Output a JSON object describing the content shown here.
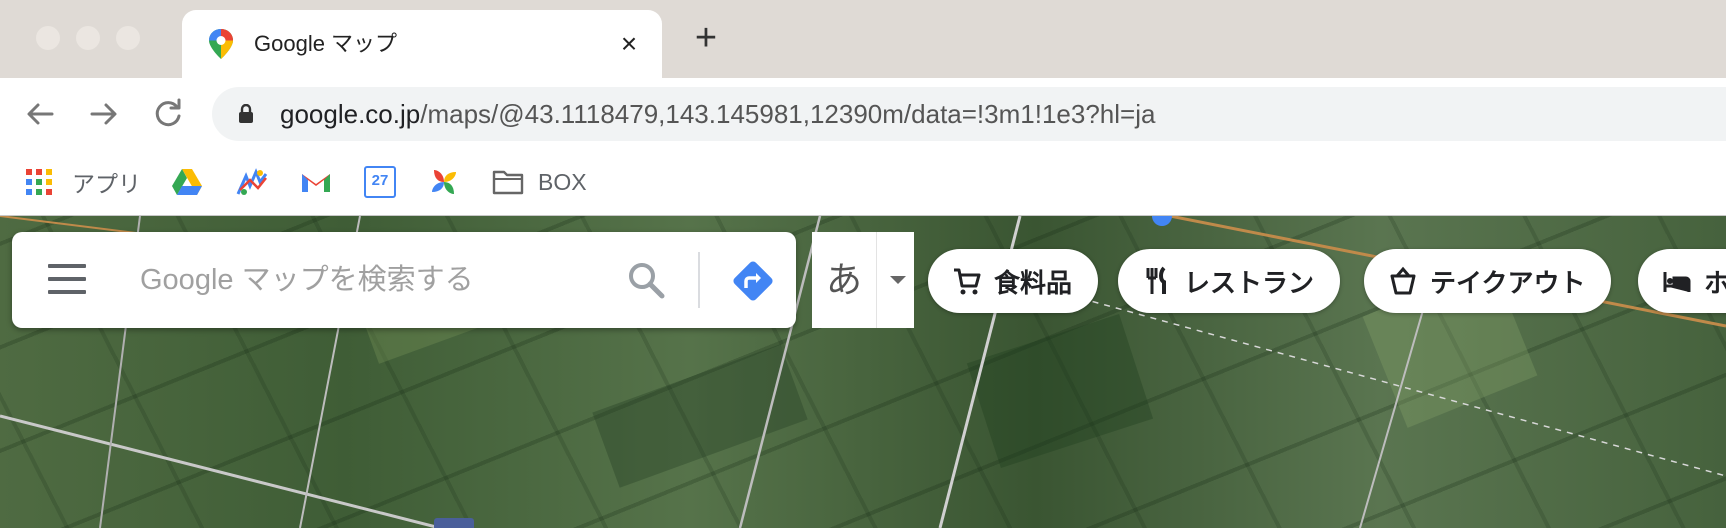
{
  "browser": {
    "tab": {
      "title": "Google マップ",
      "close_glyph": "×"
    },
    "new_tab_glyph": "+",
    "address": {
      "host": "google.co.jp",
      "path": "/maps/@43.1118479,143.145981,12390m/data=!3m1!1e3?hl=ja"
    },
    "bookmarks": [
      {
        "icon": "apps-grid-icon",
        "label": "アプリ"
      },
      {
        "icon": "google-drive-icon",
        "label": ""
      },
      {
        "icon": "colorful-app-icon",
        "label": ""
      },
      {
        "icon": "gmail-icon",
        "label": ""
      },
      {
        "icon": "google-calendar-icon",
        "label": "27"
      },
      {
        "icon": "google-photos-icon",
        "label": ""
      },
      {
        "icon": "folder-icon",
        "label": "BOX"
      }
    ]
  },
  "maps": {
    "search": {
      "placeholder": "Google マップを検索する",
      "value": ""
    },
    "ime": {
      "char": "あ"
    },
    "chips": [
      {
        "icon": "cart-icon",
        "label": "食料品"
      },
      {
        "icon": "restaurant-icon",
        "label": "レストラン"
      },
      {
        "icon": "takeout-icon",
        "label": "テイクアウト"
      },
      {
        "icon": "hotel-icon",
        "label": "ホ"
      }
    ]
  },
  "colors": {
    "accent_blue": "#4285f4",
    "map_green": "#4f6b42"
  }
}
